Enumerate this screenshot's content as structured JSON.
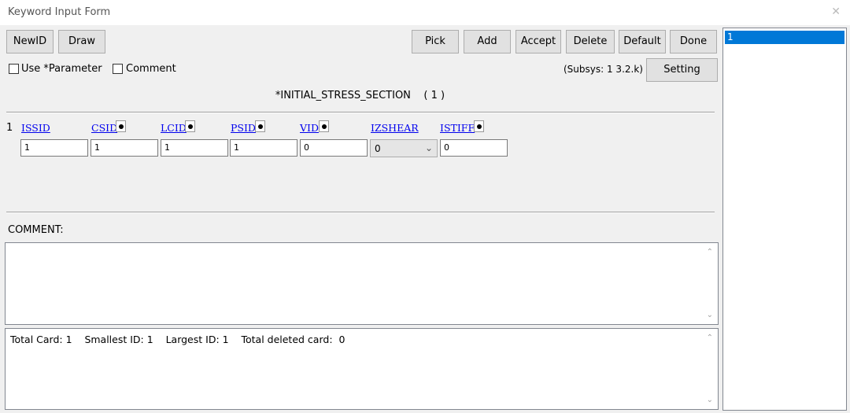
{
  "window": {
    "title": "Keyword Input Form",
    "close_glyph": "✕"
  },
  "toolbar": {
    "newid": "NewID",
    "draw": "Draw",
    "pick": "Pick",
    "add": "Add",
    "accept": "Accept",
    "delete": "Delete",
    "default": "Default",
    "done": "Done",
    "setting": "Setting"
  },
  "options": {
    "use_parameter": "Use *Parameter",
    "comment": "Comment",
    "subsys": "(Subsys: 1 3.2.k)"
  },
  "keyword": {
    "title": "*INITIAL_STRESS_SECTION    ( 1 )"
  },
  "card": {
    "row_number": "1",
    "fields": [
      {
        "label": "ISSID",
        "value": "1",
        "has_pick": false
      },
      {
        "label": "CSID",
        "value": "1",
        "has_pick": true
      },
      {
        "label": "LCID",
        "value": "1",
        "has_pick": true
      },
      {
        "label": "PSID",
        "value": "1",
        "has_pick": true
      },
      {
        "label": "VID",
        "value": "0",
        "has_pick": true
      },
      {
        "label": "IZSHEAR",
        "value": "0",
        "is_select": true
      },
      {
        "label": "ISTIFF",
        "value": "0",
        "has_pick": true
      }
    ]
  },
  "comment": {
    "label": "COMMENT:",
    "text": ""
  },
  "stats": {
    "text": "Total Card: 1    Smallest ID: 1    Largest ID: 1    Total deleted card:  0"
  },
  "id_list": {
    "items": [
      "1"
    ],
    "selected": "1"
  },
  "colors": {
    "selection": "#0078d7",
    "link": "#0000ee"
  }
}
